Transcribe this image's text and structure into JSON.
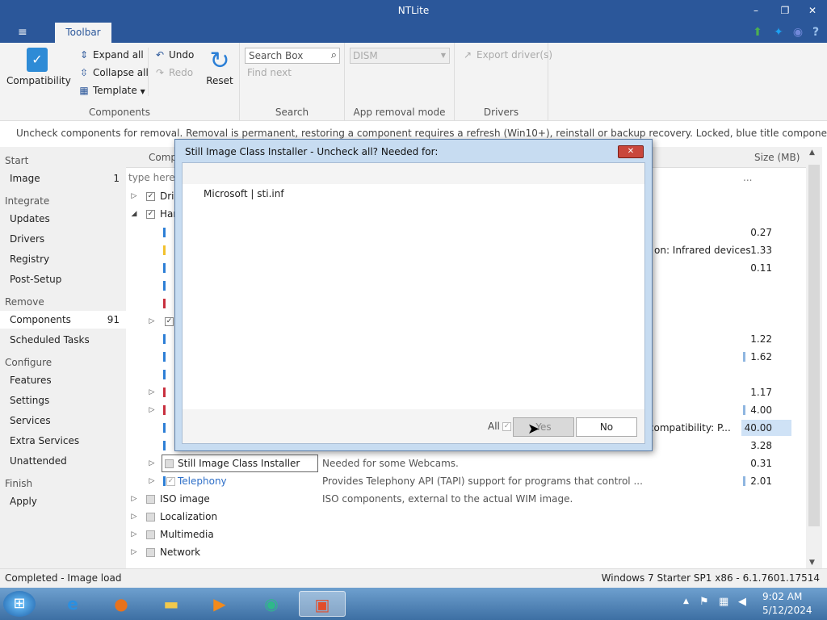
{
  "window": {
    "title": "NTLite"
  },
  "tabs": {
    "menu_icon": "≡",
    "toolbar": "Toolbar"
  },
  "ribbon": {
    "compatibility": "Compatibility",
    "expand_all": "Expand all",
    "collapse_all": "Collapse all",
    "template": "Template",
    "undo": "Undo",
    "redo": "Redo",
    "reset": "Reset",
    "search_placeholder": "Search Box",
    "find_next": "Find next",
    "dism_value": "DISM",
    "export_drivers": "Export driver(s)",
    "group_components": "Components",
    "group_search": "Search",
    "group_app_removal": "App removal mode",
    "group_drivers": "Drivers"
  },
  "info_text": "Uncheck components for removal. Removal is permanent, restoring a component requires a refresh (Win10+), reinstall or backup recovery. Locked, blue title components require a license.",
  "sidebar": {
    "start": "Start",
    "image": "Image",
    "image_count": "1",
    "integrate": "Integrate",
    "updates": "Updates",
    "drivers": "Drivers",
    "registry": "Registry",
    "post_setup": "Post-Setup",
    "remove": "Remove",
    "components": "Components",
    "components_count": "91",
    "scheduled_tasks": "Scheduled Tasks",
    "configure": "Configure",
    "features": "Features",
    "settings": "Settings",
    "services": "Services",
    "extra_services": "Extra Services",
    "unattended": "Unattended",
    "finish": "Finish",
    "apply": "Apply"
  },
  "table": {
    "col_component": "Comp",
    "col_size": "Size (MB)",
    "filter_placeholder": "type here t",
    "ellipsis": "...",
    "row_drivers": "Driv",
    "row_hardware": "Har",
    "desc_infrared": "on: Infrared devices",
    "desc_compat": "y compatibility:  P...",
    "sizes": [
      "0.27",
      "1.33",
      "0.11",
      "1.22",
      "1.62",
      "1.17",
      "4.00",
      "40.00",
      "3.28"
    ],
    "still_image_name": "Still Image Class Installer",
    "still_image_desc": "Needed for some Webcams.",
    "still_image_size": "0.31",
    "telephony_name": "Telephony",
    "telephony_desc": "Provides Telephony API (TAPI) support for programs that control ...",
    "telephony_size": "2.01",
    "iso_name": "ISO image",
    "iso_desc": "ISO components, external to the actual WIM image.",
    "localization": "Localization",
    "multimedia": "Multimedia",
    "network": "Network"
  },
  "dialog": {
    "title": "Still Image Class Installer - Uncheck all? Needed for:",
    "item": "Microsoft  |  sti.inf",
    "all_label": "All",
    "yes": "Yes",
    "no": "No"
  },
  "status": {
    "left": "Completed - Image load",
    "right": "Windows 7 Starter SP1 x86 - 6.1.7601.17514"
  },
  "taskbar": {
    "time": "9:02 AM",
    "date": "5/12/2024"
  },
  "colors": {
    "accent": "#2b579a",
    "close_red": "#c9473c",
    "dialog_frame": "#c7dcf1",
    "highlight_size": "#cfe2f6"
  }
}
